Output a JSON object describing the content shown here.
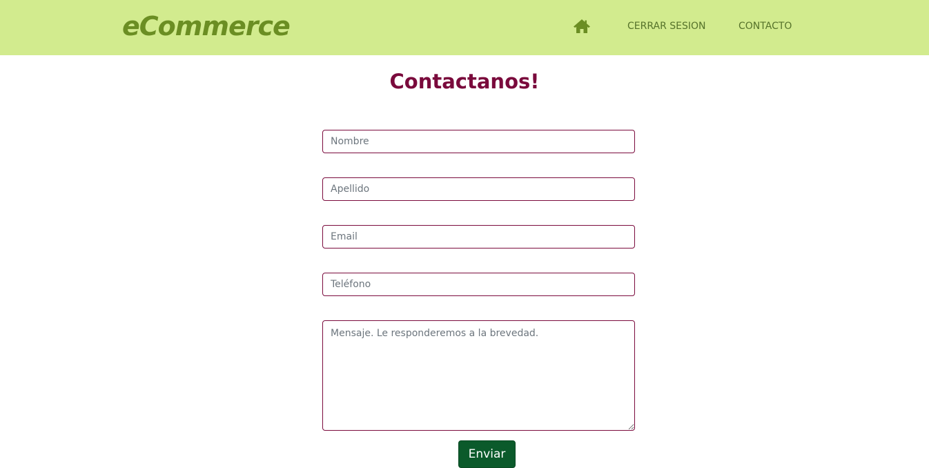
{
  "navbar": {
    "brand": "eCommerce",
    "home_icon": "home-icon",
    "links": [
      {
        "label": "CERRAR SESION"
      },
      {
        "label": "CONTACTO"
      }
    ],
    "colors": {
      "background": "#d2eb8e",
      "brand": "#6b8e23",
      "link": "#55722a"
    }
  },
  "main": {
    "title": "Contactanos!",
    "title_color": "#7a0a3c"
  },
  "form": {
    "nombre": {
      "placeholder": "Nombre",
      "value": ""
    },
    "apellido": {
      "placeholder": "Apellido",
      "value": ""
    },
    "email": {
      "placeholder": "Email",
      "value": ""
    },
    "telefono": {
      "placeholder": "Teléfono",
      "value": ""
    },
    "mensaje": {
      "placeholder": "Mensaje. Le responderemos a la brevedad.",
      "value": ""
    },
    "submit_label": "Enviar",
    "border_color": "#7a0a3c",
    "submit_color": "#0b5a2b"
  }
}
